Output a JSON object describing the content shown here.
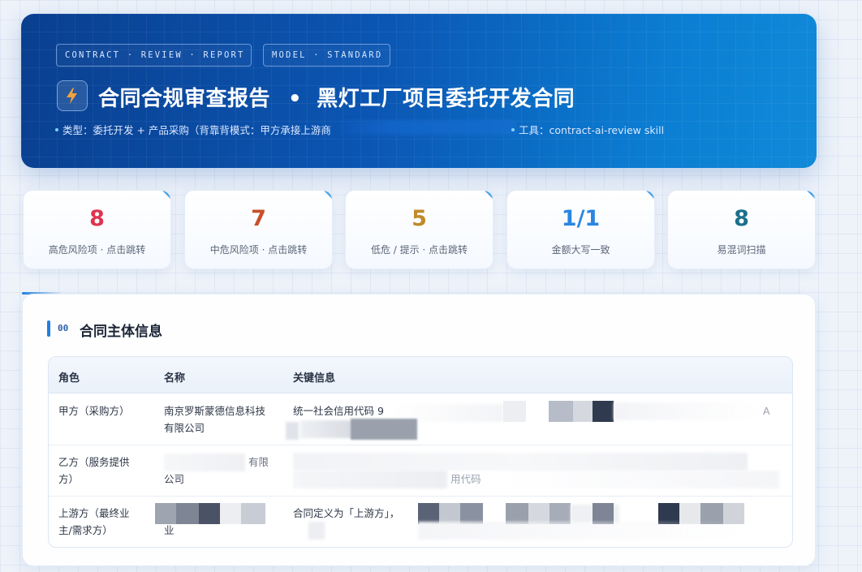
{
  "header": {
    "pill_1": "CONTRACT · REVIEW · REPORT",
    "pill_2": "MODEL · STANDARD",
    "title_left": "合同合规审查报告",
    "title_sep": "•",
    "title_right": "黑灯工厂项目委托开发合同",
    "meta_type": "类型：委托开发 + 产品采购（背靠背模式：甲方承接上游商",
    "meta_tool": "工具：contract-ai-review skill"
  },
  "stats": [
    {
      "value": "8",
      "label": "高危风险项 · 点击跳转",
      "color": "#e0334f"
    },
    {
      "value": "7",
      "label": "中危风险项 · 点击跳转",
      "color": "#c8502a"
    },
    {
      "value": "5",
      "label": "低危 / 提示 · 点击跳转",
      "color": "#c08a2a"
    },
    {
      "value": "1/1",
      "label": "金额大写一致",
      "color": "#2a86e0"
    },
    {
      "value": "8",
      "label": "易混词扫描",
      "color": "#1b6f8c"
    }
  ],
  "section": {
    "number": "00",
    "title": "合同主体信息",
    "columns": [
      "角色",
      "名称",
      "关键信息"
    ],
    "rows": [
      {
        "role_l1": "甲方（采购方）",
        "role_l2": "",
        "name_l1": "南京罗斯蒙德信息科技",
        "name_l2": "有限公司",
        "info_l1": "统一社会信用代码 9",
        "info_l2": "",
        "info_tail": "A"
      },
      {
        "role_l1": "乙方（服务提供",
        "role_l2": "方）",
        "name_l1": "有限",
        "name_l2": "公司",
        "info_l1": "",
        "info_l2": "用代码",
        "info_tail": ""
      },
      {
        "role_l1": "上游方（最终业",
        "role_l2": "主/需求方）",
        "name_l1": "",
        "name_l2": "业",
        "info_l1": "合同定义为「上游方」，",
        "info_l2": "",
        "info_tail": ""
      }
    ]
  }
}
